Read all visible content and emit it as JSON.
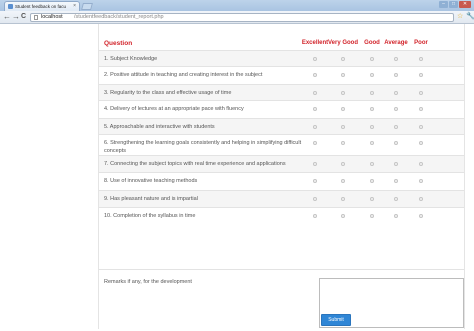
{
  "browser": {
    "tab_title": "Student feedback on facu",
    "tab_close": "×",
    "back_glyph": "←",
    "forward_glyph": "→",
    "reload_glyph": "C",
    "url_host": "localhost",
    "url_path": "/studentfeedback/student_report.php",
    "star_glyph": "☆",
    "wrench_glyph": "🔧",
    "window_minimize": "–",
    "window_maximize": "□",
    "window_close": "✕"
  },
  "form": {
    "header_question": "Question",
    "rating_columns": [
      "Excellent",
      "Very Good",
      "Good",
      "Average",
      "Poor"
    ],
    "questions": [
      "1. Subject Knowledge",
      "2. Positive attitude in teaching and creating interest in the subject",
      "3. Regularity to the class and effective usage of time",
      "4. Delivery of lectures at an appropriate pace with fluency",
      "5. Approachable and interactive with students",
      "6. Strengthening the learning goals consistently and helping in simplifying difficult concepts",
      "7. Connecting the subject topics with real time experience and applications",
      "8. Use of innovative teaching methods",
      "9. Has pleasant nature and is impartial",
      "10. Completion of the syllabus in time"
    ],
    "remarks_label": "Remarks if any, for the development",
    "remarks_value": "",
    "submit_label": "Submit"
  },
  "colors": {
    "header_text": "#d2232a",
    "button_blue": "#2f86d6",
    "row_alt": "#f5f5f5"
  }
}
